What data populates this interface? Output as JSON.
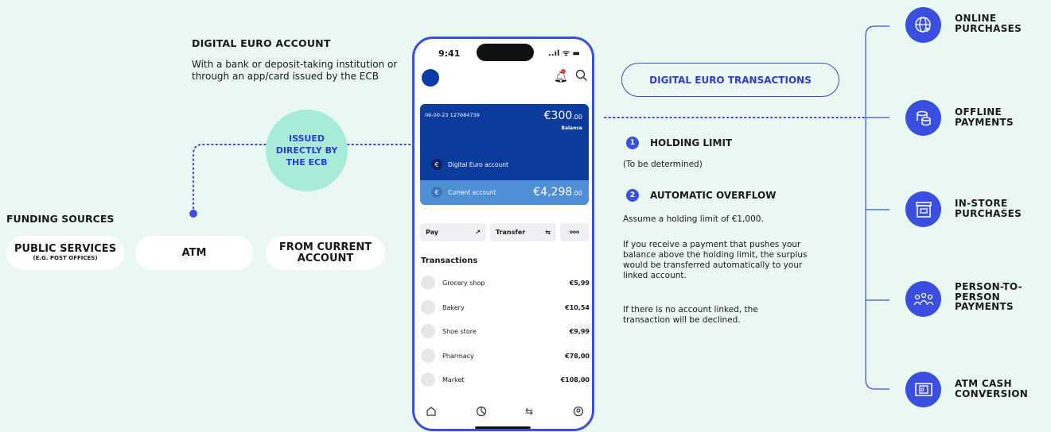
{
  "left": {
    "account_title": "DIGITAL EURO ACCOUNT",
    "account_desc": "With a bank or deposit-taking institution or through an app/card issued by the ECB",
    "issued": "ISSUED DIRECTLY BY THE ECB",
    "funding_title": "FUNDING SOURCES",
    "sources": [
      {
        "main": "PUBLIC SERVICES",
        "sub": "(E.G. POST OFFICES)"
      },
      {
        "main": "ATM",
        "sub": ""
      },
      {
        "main": "FROM CURRENT ACCOUNT",
        "sub": ""
      }
    ]
  },
  "phone": {
    "time": "9:41",
    "status_icons": "..ıl ᯤ ▬",
    "card": {
      "number": "06-00-23  127684739",
      "amount": "€300",
      "amount_dec": ".00",
      "balance_label": "Balance",
      "euro_label": "Digital Euro account",
      "current_label": "Current account",
      "current_amount": "€4,298",
      "current_dec": ".00"
    },
    "actions": [
      {
        "label": "Pay",
        "icon": "↗"
      },
      {
        "label": "Transfer",
        "icon": "⇆"
      },
      {
        "label": "",
        "icon": "ooo"
      }
    ],
    "transactions_title": "Transactions",
    "transactions": [
      {
        "name": "Grocery shop",
        "amount": "€5,99"
      },
      {
        "name": "Bakery",
        "amount": "€10,54"
      },
      {
        "name": "Shoe store",
        "amount": "€9,99"
      },
      {
        "name": "Pharmacy",
        "amount": "€78,00"
      },
      {
        "name": "Market",
        "amount": "€108,00"
      }
    ]
  },
  "middle": {
    "box": "DIGITAL EURO TRANSACTIONS",
    "s1_num": "1",
    "s1_title": "HOLDING LIMIT",
    "s1_body": "(To be determined)",
    "s2_num": "2",
    "s2_title": "AUTOMATIC OVERFLOW",
    "s2_p1": "Assume a holding limit of €1,000.",
    "s2_p2": "If you receive a payment that pushes your balance above the holding limit, the surplus would be transferred automatically to your linked account.",
    "s2_p3": "If there is no account linked, the transaction will be declined."
  },
  "right": {
    "items": [
      {
        "label": "ONLINE PURCHASES",
        "icon": "globe-cursor-icon"
      },
      {
        "label": "OFFLINE PAYMENTS",
        "icon": "coins-icon"
      },
      {
        "label": "IN-STORE PURCHASES",
        "icon": "store-icon"
      },
      {
        "label": "PERSON-TO-PERSON PAYMENTS",
        "icon": "people-icon"
      },
      {
        "label": "ATM CASH CONVERSION",
        "icon": "atm-icon"
      }
    ]
  },
  "colors": {
    "accent": "#3a4ee0",
    "mint": "#a8ebd8",
    "background": "#e9f8f3",
    "card_dark": "#0b3b9c",
    "card_light": "#4e8fd6"
  }
}
